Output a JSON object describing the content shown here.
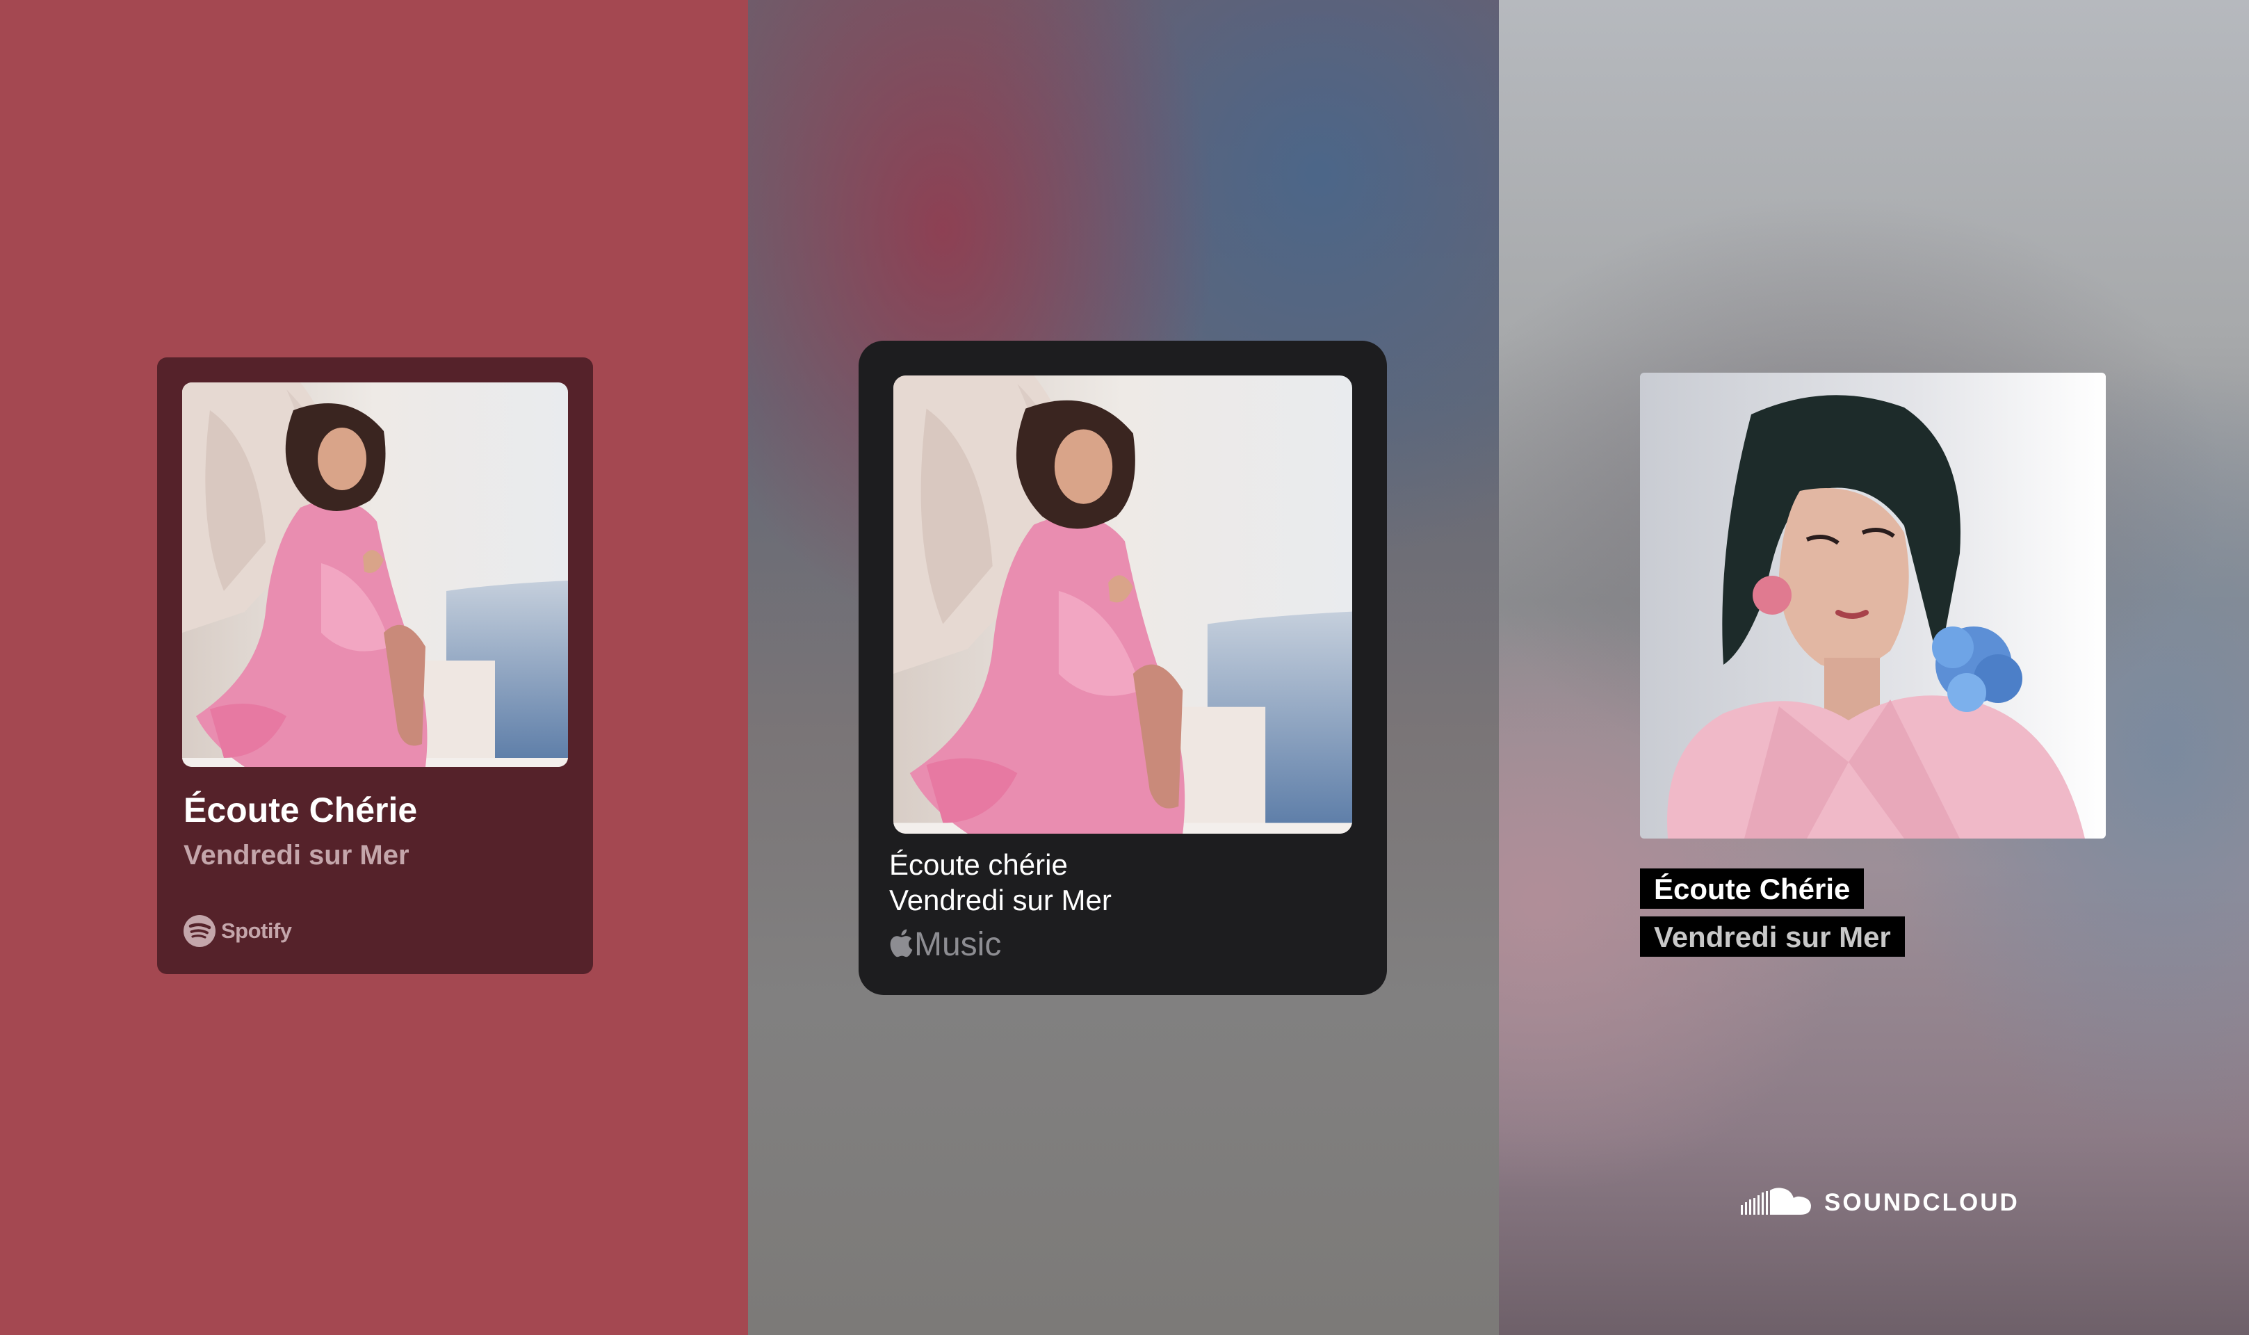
{
  "colors": {
    "spotify_bg": "#a44851",
    "spotify_card": "#55222a",
    "spotify_secondary_text": "#c4a6ab",
    "apple_card": "#1d1d1f",
    "apple_logo": "#8d8d92",
    "soundcloud_label_bg": "#000000"
  },
  "spotify": {
    "cover_image": "album-cover-woman-pink-dress-on-shell-chair",
    "title": "Écoute Chérie",
    "artist": "Vendredi sur Mer",
    "logo_icon": "spotify-icon",
    "logo_text": "Spotify"
  },
  "apple_music": {
    "cover_image": "album-cover-woman-pink-dress-on-shell-chair",
    "title": "Écoute chérie",
    "artist": "Vendredi sur Mer",
    "logo_icon": "apple-icon",
    "logo_text": "Music"
  },
  "soundcloud": {
    "cover_image": "portrait-woman-pink-blazer-blue-flower-earring",
    "title": "Écoute Chérie",
    "artist": "Vendredi sur Mer",
    "logo_icon": "soundcloud-icon",
    "logo_text": "SOUNDCLOUD"
  }
}
